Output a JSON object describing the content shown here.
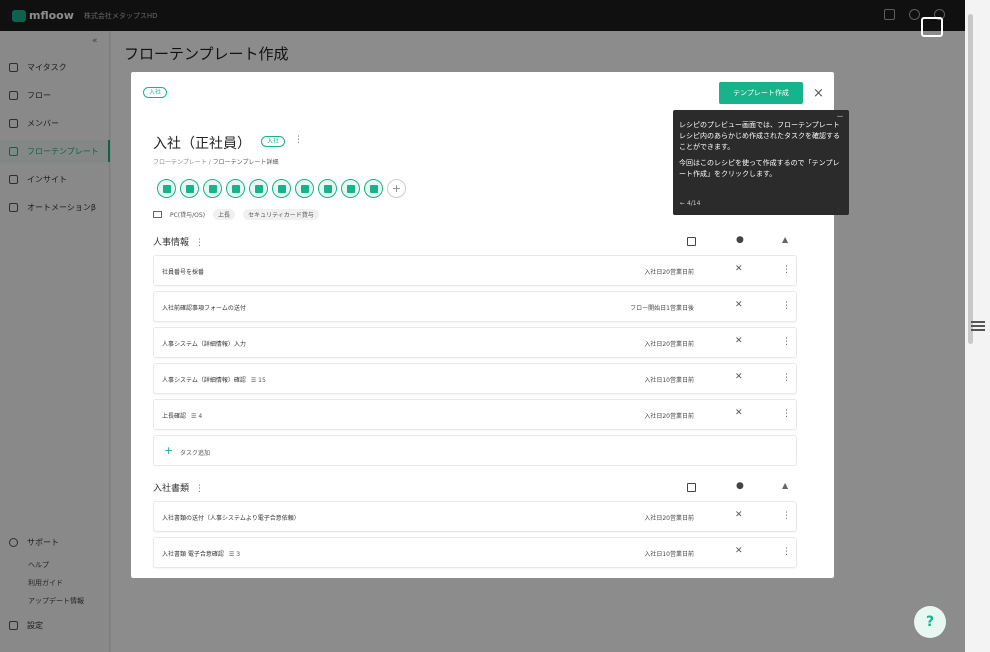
{
  "topbar": {
    "logo": "mfloow",
    "company": "株式会社メタップスHD"
  },
  "sidebar": {
    "items": [
      {
        "label": "マイタスク",
        "icon": "check-circle-icon"
      },
      {
        "label": "フロー",
        "icon": "dots-icon"
      },
      {
        "label": "メンバー",
        "icon": "users-icon"
      },
      {
        "label": "フローテンプレート",
        "icon": "template-icon",
        "active": true
      },
      {
        "label": "インサイト",
        "icon": "chart-icon"
      },
      {
        "label": "オートメーションβ",
        "icon": "sync-icon"
      }
    ],
    "support": {
      "label": "サポート",
      "items": [
        "ヘルプ",
        "利用ガイド",
        "アップデート情報"
      ]
    },
    "settings": "設定"
  },
  "main": {
    "title": "フローテンプレート作成"
  },
  "modal": {
    "tag": "入社",
    "create_button": "テンプレート作成",
    "close": "×",
    "title": "入社（正社員）",
    "title_tag": "入社",
    "breadcrumb_root": "フローテンプレート",
    "breadcrumb_current": "フローテンプレート詳細",
    "meta": {
      "pc": "PC(貸与/OS)",
      "boss": "上長",
      "card": "セキュリティカード貸与"
    },
    "sections": [
      {
        "name": "人事情報",
        "tasks": [
          {
            "name": "社員番号を採番",
            "count": "",
            "due": "入社日20営業日前"
          },
          {
            "name": "入社前確認事項フォームの送付",
            "count": "",
            "due": "フロー開始日1営業日後"
          },
          {
            "name": "人事システム（詳細情報）入力",
            "count": "",
            "due": "入社日20営業日前"
          },
          {
            "name": "人事システム（詳細情報）確認",
            "count": "15",
            "due": "入社日10営業日前"
          },
          {
            "name": "上長確認",
            "count": "4",
            "due": "入社日20営業日前"
          }
        ],
        "add_task": "タスク追加"
      },
      {
        "name": "入社書類",
        "tasks": [
          {
            "name": "入社書類の送付（人事システムより電子合意依頼）",
            "count": "",
            "due": "入社日20営業日前"
          },
          {
            "name": "入社書類 電子合意確認",
            "count": "3",
            "due": "入社日10営業日前"
          }
        ]
      }
    ]
  },
  "tooltip": {
    "text1": "レシピのプレビュー画面では、フローテンプレートレシピ内のあらかじめ作成されたタスクを確認することができます。",
    "text2": "今回はこのレシピを使って作成するので「テンプレート作成」をクリックします。",
    "step": "4/14",
    "close": "－"
  },
  "colors": {
    "accent": "#18b38a",
    "topbar": "#1e1e1e",
    "tooltip": "#2b2b2b"
  }
}
